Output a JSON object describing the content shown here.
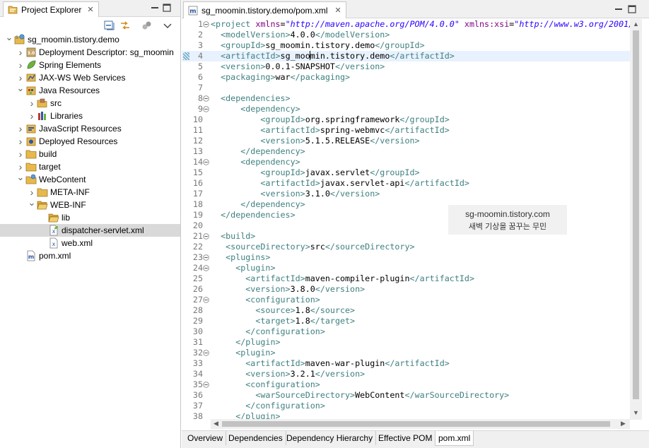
{
  "explorer": {
    "tab_title": "Project Explorer",
    "close_glyph": "✕",
    "tree": [
      {
        "label": "sg_moomin.tistory.demo",
        "depth": 0,
        "twisty": "open",
        "icon": "web-project-icon"
      },
      {
        "label": "Deployment Descriptor: sg_moomin",
        "depth": 1,
        "twisty": "closed",
        "icon": "deployment-descriptor-icon"
      },
      {
        "label": "Spring Elements",
        "depth": 1,
        "twisty": "closed",
        "icon": "spring-leaf-icon"
      },
      {
        "label": "JAX-WS Web Services",
        "depth": 1,
        "twisty": "closed",
        "icon": "web-services-icon"
      },
      {
        "label": "Java Resources",
        "depth": 1,
        "twisty": "open",
        "icon": "java-resources-icon"
      },
      {
        "label": "src",
        "depth": 2,
        "twisty": "closed",
        "icon": "source-folder-icon"
      },
      {
        "label": "Libraries",
        "depth": 2,
        "twisty": "closed",
        "icon": "libraries-icon"
      },
      {
        "label": "JavaScript Resources",
        "depth": 1,
        "twisty": "closed",
        "icon": "javascript-resources-icon"
      },
      {
        "label": "Deployed Resources",
        "depth": 1,
        "twisty": "closed",
        "icon": "deployed-resources-icon"
      },
      {
        "label": "build",
        "depth": 1,
        "twisty": "closed",
        "icon": "folder-icon"
      },
      {
        "label": "target",
        "depth": 1,
        "twisty": "closed",
        "icon": "folder-icon"
      },
      {
        "label": "WebContent",
        "depth": 1,
        "twisty": "open",
        "icon": "web-folder-icon"
      },
      {
        "label": "META-INF",
        "depth": 2,
        "twisty": "closed",
        "icon": "folder-icon"
      },
      {
        "label": "WEB-INF",
        "depth": 2,
        "twisty": "open",
        "icon": "open-folder-icon"
      },
      {
        "label": "lib",
        "depth": 3,
        "twisty": "none",
        "icon": "open-folder-icon"
      },
      {
        "label": "dispatcher-servlet.xml",
        "depth": 3,
        "twisty": "none",
        "icon": "spring-xml-file-icon",
        "selected": true
      },
      {
        "label": "web.xml",
        "depth": 3,
        "twisty": "none",
        "icon": "xml-file-icon"
      },
      {
        "label": "pom.xml",
        "depth": 1,
        "twisty": "none",
        "icon": "maven-pom-icon"
      }
    ]
  },
  "editor": {
    "tab_title": "sg_moomin.tistory.demo/pom.xml",
    "close_glyph": "✕",
    "current_line": 4,
    "lines": [
      {
        "n": "1",
        "fold": "minus",
        "indent": "",
        "parts": [
          [
            "tag",
            "<project "
          ],
          [
            "attr",
            "xmlns"
          ],
          [
            "val",
            "="
          ],
          [
            "str",
            "\"http://maven.apache.org/POM/4.0.0\""
          ],
          [
            "val",
            " "
          ],
          [
            "attr",
            "xmlns:xsi"
          ],
          [
            "val",
            "="
          ],
          [
            "str",
            "\"http://www.w3.org/2001/"
          ]
        ]
      },
      {
        "n": "2",
        "indent": "  ",
        "parts": [
          [
            "tag",
            "<modelVersion>"
          ],
          [
            "val",
            "4.0.0"
          ],
          [
            "tag",
            "</modelVersion>"
          ]
        ]
      },
      {
        "n": "3",
        "indent": "  ",
        "parts": [
          [
            "tag",
            "<groupId>"
          ],
          [
            "val",
            "sg_moomin.tistory.demo"
          ],
          [
            "tag",
            "</groupId>"
          ]
        ]
      },
      {
        "n": "4",
        "indent": "  ",
        "parts": [
          [
            "tag",
            "<artifactId>"
          ],
          [
            "val",
            "sg_moo"
          ],
          [
            "caret",
            ""
          ],
          [
            "val",
            "min.tistory.demo"
          ],
          [
            "tag",
            "</artifactId>"
          ]
        ]
      },
      {
        "n": "5",
        "indent": "  ",
        "parts": [
          [
            "tag",
            "<version>"
          ],
          [
            "val",
            "0.0.1-SNAPSHOT"
          ],
          [
            "tag",
            "</version>"
          ]
        ]
      },
      {
        "n": "6",
        "indent": "  ",
        "parts": [
          [
            "tag",
            "<packaging>"
          ],
          [
            "val",
            "war"
          ],
          [
            "tag",
            "</packaging>"
          ]
        ]
      },
      {
        "n": "7",
        "indent": "",
        "parts": []
      },
      {
        "n": "8",
        "fold": "minus",
        "indent": "  ",
        "parts": [
          [
            "tag",
            "<dependencies>"
          ]
        ]
      },
      {
        "n": "9",
        "fold": "minus",
        "indent": "      ",
        "parts": [
          [
            "tag",
            "<dependency>"
          ]
        ]
      },
      {
        "n": "10",
        "indent": "          ",
        "parts": [
          [
            "tag",
            "<groupId>"
          ],
          [
            "val",
            "org.springframework"
          ],
          [
            "tag",
            "</groupId>"
          ]
        ]
      },
      {
        "n": "11",
        "indent": "          ",
        "parts": [
          [
            "tag",
            "<artifactId>"
          ],
          [
            "val",
            "spring-webmvc"
          ],
          [
            "tag",
            "</artifactId>"
          ]
        ]
      },
      {
        "n": "12",
        "indent": "          ",
        "parts": [
          [
            "tag",
            "<version>"
          ],
          [
            "val",
            "5.1.5.RELEASE"
          ],
          [
            "tag",
            "</version>"
          ]
        ]
      },
      {
        "n": "13",
        "indent": "      ",
        "parts": [
          [
            "tag",
            "</dependency>"
          ]
        ]
      },
      {
        "n": "14",
        "fold": "minus",
        "indent": "      ",
        "parts": [
          [
            "tag",
            "<dependency>"
          ]
        ]
      },
      {
        "n": "15",
        "indent": "          ",
        "parts": [
          [
            "tag",
            "<groupId>"
          ],
          [
            "val",
            "javax.servlet"
          ],
          [
            "tag",
            "</groupId>"
          ]
        ]
      },
      {
        "n": "16",
        "indent": "          ",
        "parts": [
          [
            "tag",
            "<artifactId>"
          ],
          [
            "val",
            "javax.servlet-api"
          ],
          [
            "tag",
            "</artifactId>"
          ]
        ]
      },
      {
        "n": "17",
        "indent": "          ",
        "parts": [
          [
            "tag",
            "<version>"
          ],
          [
            "val",
            "3.1.0"
          ],
          [
            "tag",
            "</version>"
          ]
        ]
      },
      {
        "n": "18",
        "indent": "      ",
        "parts": [
          [
            "tag",
            "</dependency>"
          ]
        ]
      },
      {
        "n": "19",
        "indent": "  ",
        "parts": [
          [
            "tag",
            "</dependencies>"
          ]
        ]
      },
      {
        "n": "20",
        "indent": "",
        "parts": []
      },
      {
        "n": "21",
        "fold": "minus",
        "indent": "  ",
        "parts": [
          [
            "tag",
            "<build>"
          ]
        ]
      },
      {
        "n": "22",
        "indent": "   ",
        "parts": [
          [
            "tag",
            "<sourceDirectory>"
          ],
          [
            "val",
            "src"
          ],
          [
            "tag",
            "</sourceDirectory>"
          ]
        ]
      },
      {
        "n": "23",
        "fold": "minus",
        "indent": "   ",
        "parts": [
          [
            "tag",
            "<plugins>"
          ]
        ]
      },
      {
        "n": "24",
        "fold": "minus",
        "indent": "     ",
        "parts": [
          [
            "tag",
            "<plugin>"
          ]
        ]
      },
      {
        "n": "25",
        "indent": "       ",
        "parts": [
          [
            "tag",
            "<artifactId>"
          ],
          [
            "val",
            "maven-compiler-plugin"
          ],
          [
            "tag",
            "</artifactId>"
          ]
        ]
      },
      {
        "n": "26",
        "indent": "       ",
        "parts": [
          [
            "tag",
            "<version>"
          ],
          [
            "val",
            "3.8.0"
          ],
          [
            "tag",
            "</version>"
          ]
        ]
      },
      {
        "n": "27",
        "fold": "minus",
        "indent": "       ",
        "parts": [
          [
            "tag",
            "<configuration>"
          ]
        ]
      },
      {
        "n": "28",
        "indent": "         ",
        "parts": [
          [
            "tag",
            "<source>"
          ],
          [
            "val",
            "1.8"
          ],
          [
            "tag",
            "</source>"
          ]
        ]
      },
      {
        "n": "29",
        "indent": "         ",
        "parts": [
          [
            "tag",
            "<target>"
          ],
          [
            "val",
            "1.8"
          ],
          [
            "tag",
            "</target>"
          ]
        ]
      },
      {
        "n": "30",
        "indent": "       ",
        "parts": [
          [
            "tag",
            "</configuration>"
          ]
        ]
      },
      {
        "n": "31",
        "indent": "     ",
        "parts": [
          [
            "tag",
            "</plugin>"
          ]
        ]
      },
      {
        "n": "32",
        "fold": "minus",
        "indent": "     ",
        "parts": [
          [
            "tag",
            "<plugin>"
          ]
        ]
      },
      {
        "n": "33",
        "indent": "       ",
        "parts": [
          [
            "tag",
            "<artifactId>"
          ],
          [
            "val",
            "maven-war-plugin"
          ],
          [
            "tag",
            "</artifactId>"
          ]
        ]
      },
      {
        "n": "34",
        "indent": "       ",
        "parts": [
          [
            "tag",
            "<version>"
          ],
          [
            "val",
            "3.2.1"
          ],
          [
            "tag",
            "</version>"
          ]
        ]
      },
      {
        "n": "35",
        "fold": "minus",
        "indent": "       ",
        "parts": [
          [
            "tag",
            "<configuration>"
          ]
        ]
      },
      {
        "n": "36",
        "indent": "         ",
        "parts": [
          [
            "tag",
            "<warSourceDirectory>"
          ],
          [
            "val",
            "WebContent"
          ],
          [
            "tag",
            "</warSourceDirectory>"
          ]
        ]
      },
      {
        "n": "37",
        "indent": "       ",
        "parts": [
          [
            "tag",
            "</configuration>"
          ]
        ]
      },
      {
        "n": "38",
        "indent": "     ",
        "parts": [
          [
            "tag",
            "</plugin>"
          ]
        ]
      }
    ],
    "bottom_tabs": [
      "Overview",
      "Dependencies",
      "Dependency Hierarchy",
      "Effective POM",
      "pom.xml"
    ],
    "active_bottom_tab": "pom.xml"
  },
  "watermark": {
    "line1": "sg-moomin.tistory.com",
    "line2": "새벽 기상을 꿈꾸는 무민"
  },
  "colors": {
    "tag": "#3f7f7f",
    "attribute": "#7f007f",
    "string": "#2a00ff",
    "line_number": "#787878",
    "current_line_bg": "#e8f2fe",
    "selection_bg": "#d9d9d9"
  }
}
